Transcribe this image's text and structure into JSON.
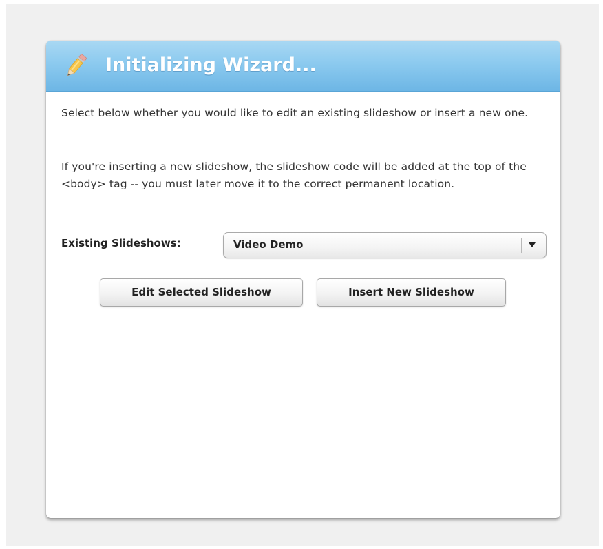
{
  "wizard": {
    "title": "Initializing Wizard...",
    "header_icon": "pencil-icon",
    "intro": "Select below whether you would like to edit an existing slideshow or insert a new one.",
    "notice": "If you're inserting a new slideshow, the slideshow code will be added at the top of the <body> tag -- you must later move it to the correct permanent location."
  },
  "selector": {
    "label": "Existing Slideshows:",
    "selected_value": "Video Demo",
    "dropdown_icon": "chevron-down-icon"
  },
  "actions": {
    "edit_label": "Edit Selected Slideshow",
    "insert_label": "Insert New Slideshow"
  },
  "colors": {
    "header_blue": "#8ccaef",
    "panel_background": "#ffffff",
    "page_background": "#f0f0f0"
  }
}
